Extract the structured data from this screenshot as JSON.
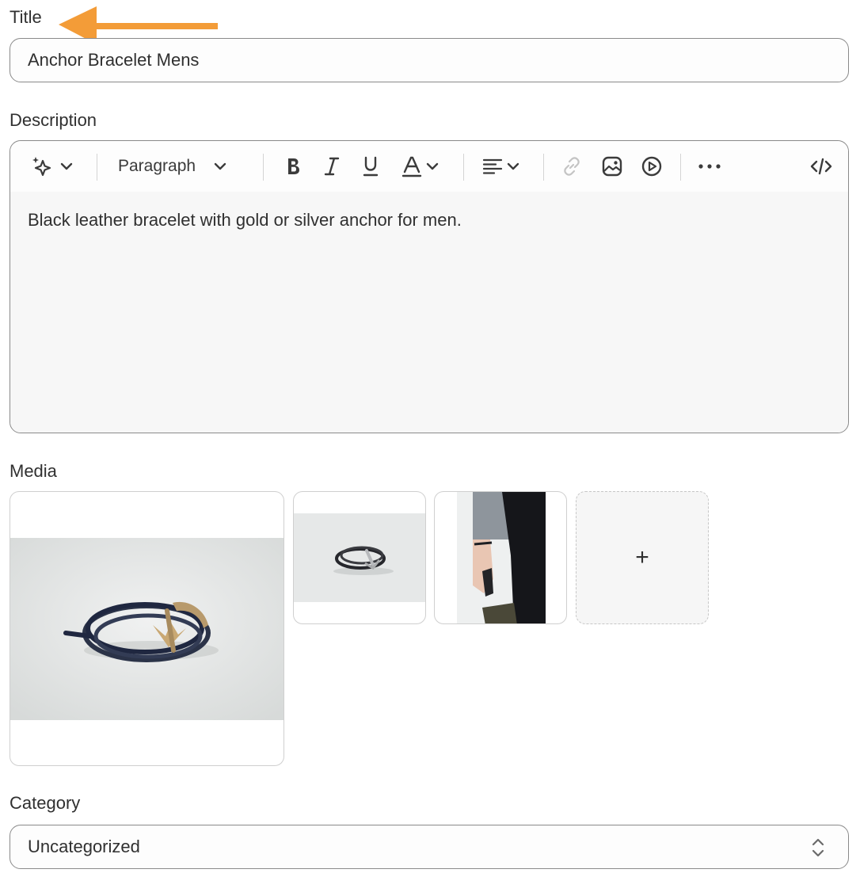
{
  "title_section": {
    "label": "Title",
    "value": "Anchor Bracelet Mens"
  },
  "description_section": {
    "label": "Description",
    "toolbar": {
      "block_format": "Paragraph"
    },
    "content": "Black leather bracelet with gold or silver anchor for men."
  },
  "media_section": {
    "label": "Media",
    "items": [
      {
        "name": "media-image-1",
        "kind": "anchor-bracelet-closeup"
      },
      {
        "name": "media-image-2",
        "kind": "bracelet-on-table"
      },
      {
        "name": "media-image-3",
        "kind": "bracelet-worn-on-wrist"
      }
    ],
    "add_label": "+"
  },
  "category_section": {
    "label": "Category",
    "value": "Uncategorized"
  },
  "colors": {
    "annotation_arrow": "#f39c38",
    "border": "#8a8a8a",
    "editor_bg": "#f7f7f7"
  }
}
